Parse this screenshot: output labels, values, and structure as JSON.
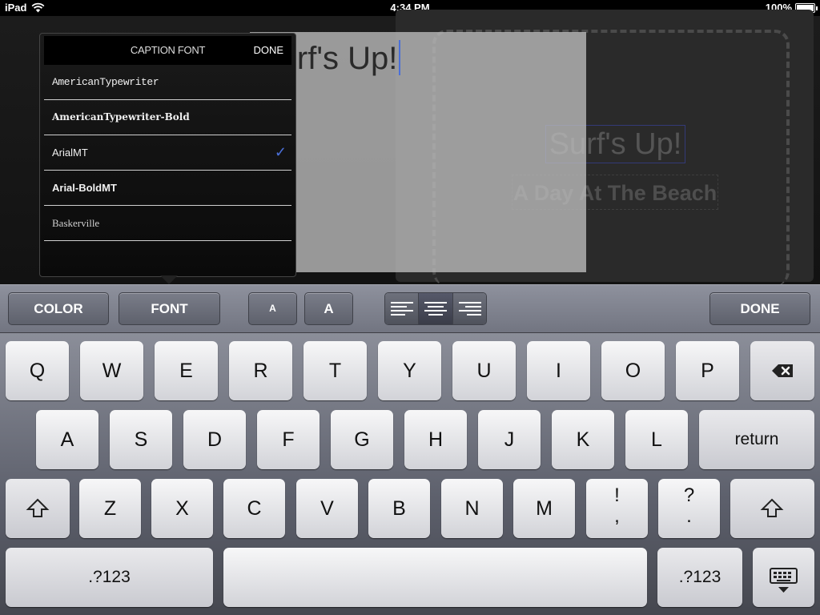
{
  "status": {
    "device": "iPad",
    "time": "4:34 PM",
    "battery": "100%",
    "battery_level": 1.0
  },
  "canvas": {
    "caption": "Surf's Up!",
    "subcaption": "A Day At The Beach",
    "editing_text": "Surf's Up!"
  },
  "popover": {
    "title": "CAPTION FONT",
    "done_label": "DONE",
    "fonts": [
      {
        "label": "AmericanTypewriter",
        "selected": false
      },
      {
        "label": "AmericanTypewriter-Bold",
        "selected": false
      },
      {
        "label": "ArialMT",
        "selected": true
      },
      {
        "label": "Arial-BoldMT",
        "selected": false
      },
      {
        "label": "Baskerville",
        "selected": false
      }
    ],
    "check_glyph": "✓"
  },
  "toolbar": {
    "color_label": "COLOR",
    "font_label": "FONT",
    "size_small_label": "A",
    "size_large_label": "A",
    "done_label": "DONE",
    "alignment_selected": "center"
  },
  "keyboard": {
    "row1": [
      "Q",
      "W",
      "E",
      "R",
      "T",
      "Y",
      "U",
      "I",
      "O",
      "P"
    ],
    "row2": [
      "A",
      "S",
      "D",
      "F",
      "G",
      "H",
      "J",
      "K",
      "L"
    ],
    "row3": [
      "Z",
      "X",
      "C",
      "V",
      "B",
      "N",
      "M"
    ],
    "excl_top": "!",
    "excl_bottom": ",",
    "quest_top": "?",
    "quest_bottom": ".",
    "return_label": "return",
    "numbers_label": ".?123"
  }
}
